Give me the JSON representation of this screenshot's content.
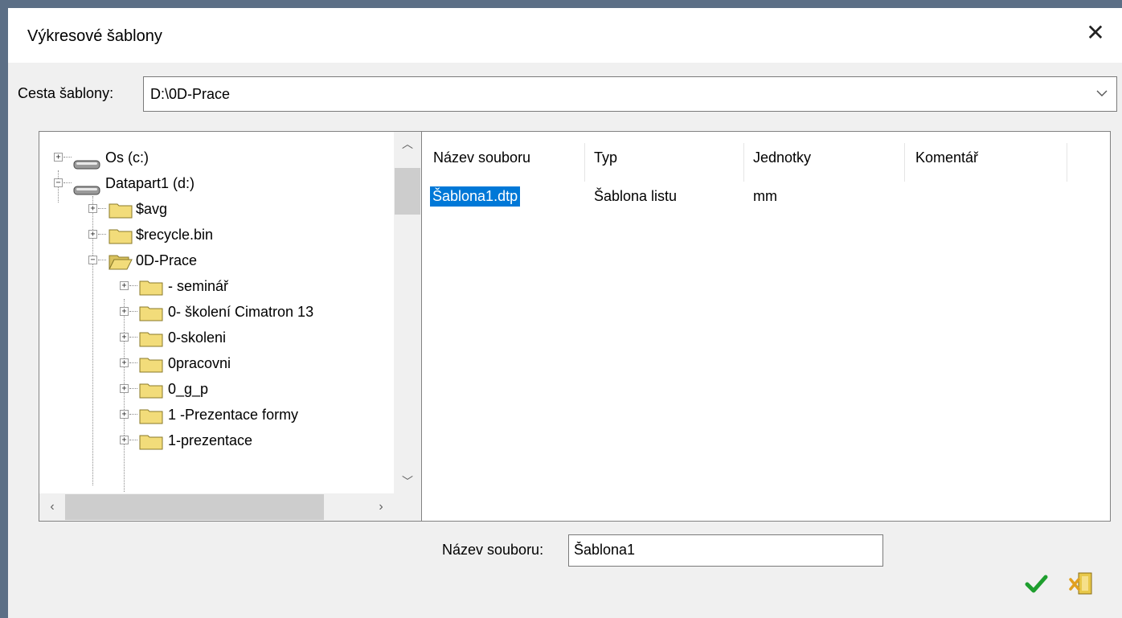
{
  "window": {
    "title": "Výkresové šablony"
  },
  "path": {
    "label": "Cesta šablony:",
    "value": "D:\\0D-Prace"
  },
  "tree": {
    "nodes": [
      {
        "label": "Os (c:)",
        "type": "drive",
        "expander": "+"
      },
      {
        "label": "Datapart1 (d:)",
        "type": "drive",
        "expander": "−"
      },
      {
        "label": "$avg",
        "type": "folder",
        "expander": "+"
      },
      {
        "label": "$recycle.bin",
        "type": "folder",
        "expander": "+"
      },
      {
        "label": "0D-Prace",
        "type": "folder-open",
        "expander": "−"
      },
      {
        "label": "- seminář",
        "type": "folder",
        "expander": "+"
      },
      {
        "label": "0- školení Cimatron 13",
        "type": "folder",
        "expander": "+"
      },
      {
        "label": "0-skoleni",
        "type": "folder",
        "expander": "+"
      },
      {
        "label": "0pracovni",
        "type": "folder",
        "expander": "+"
      },
      {
        "label": "0_g_p",
        "type": "folder",
        "expander": "+"
      },
      {
        "label": "1 -Prezentace formy",
        "type": "folder",
        "expander": "+"
      },
      {
        "label": "1-prezentace",
        "type": "folder",
        "expander": "+"
      }
    ]
  },
  "list": {
    "columns": [
      "Název souboru",
      "Typ",
      "Jednotky",
      "Komentář"
    ],
    "rows": [
      {
        "name": "Šablona1.dtp",
        "type": "Šablona listu",
        "units": "mm",
        "comment": ""
      }
    ]
  },
  "filename": {
    "label": "Název souboru:",
    "value": "Šablona1"
  },
  "buttons": {
    "ok_icon": "check-icon",
    "cancel_icon": "cancel-exit-icon"
  },
  "colors": {
    "selection": "#0078d7",
    "ok": "#1e9e2e",
    "folder": "#f2dc7a"
  }
}
